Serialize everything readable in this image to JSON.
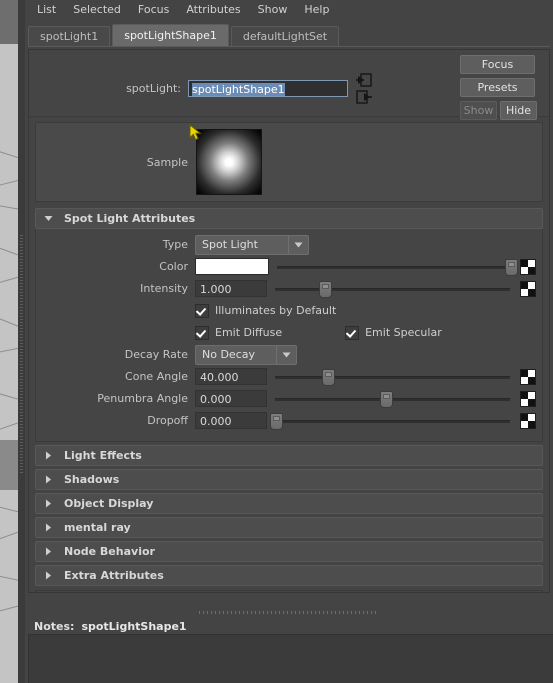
{
  "menu": {
    "items": [
      {
        "label": "List"
      },
      {
        "label": "Selected"
      },
      {
        "label": "Focus"
      },
      {
        "label": "Attributes"
      },
      {
        "label": "Show"
      },
      {
        "label": "Help"
      }
    ]
  },
  "tabs": [
    {
      "label": "spotLight1",
      "active": false
    },
    {
      "label": "spotLightShape1",
      "active": true
    },
    {
      "label": "defaultLightSet",
      "active": false
    }
  ],
  "node_header": {
    "type_label": "spotLight:",
    "name_value": "spotLightShape1",
    "focus_button": "Focus",
    "presets_button": "Presets",
    "show_button": "Show",
    "hide_button": "Hide",
    "go_to_input_icon": "arrow-into-box-icon",
    "go_to_output_icon": "arrow-out-of-box-icon"
  },
  "sample": {
    "label": "Sample",
    "swatch_center_color": "#ffffff",
    "swatch_edge_color": "#050505",
    "cursor_color": "#ecd400"
  },
  "spot_light_attributes": {
    "title": "Spot Light Attributes",
    "expanded": true,
    "type": {
      "label": "Type",
      "value": "Spot Light"
    },
    "color": {
      "label": "Color",
      "value": "#ffffff",
      "slider_percent": 100,
      "map_button_icon": "checker-map-icon"
    },
    "intensity": {
      "label": "Intensity",
      "value": "1.000",
      "slider_percent": 21,
      "map_button_icon": "checker-map-icon"
    },
    "illuminates_by_default": {
      "label": "Illuminates by Default",
      "checked": true
    },
    "emit_diffuse": {
      "label": "Emit Diffuse",
      "checked": true
    },
    "emit_specular": {
      "label": "Emit Specular",
      "checked": true
    },
    "decay_rate": {
      "label": "Decay Rate",
      "value": "No Decay"
    },
    "cone_angle": {
      "label": "Cone Angle",
      "value": "40.000",
      "slider_percent": 22,
      "map_button_icon": "checker-map-icon"
    },
    "penumbra_angle": {
      "label": "Penumbra Angle",
      "value": "0.000",
      "slider_percent": 47,
      "map_button_icon": "checker-map-icon"
    },
    "dropoff": {
      "label": "Dropoff",
      "value": "0.000",
      "slider_percent": 0,
      "map_button_icon": "checker-map-icon"
    }
  },
  "collapsed_sections": [
    {
      "title": "Light Effects"
    },
    {
      "title": "Shadows"
    },
    {
      "title": "Object Display"
    },
    {
      "title": "mental ray"
    },
    {
      "title": "Node Behavior"
    },
    {
      "title": "Extra Attributes"
    }
  ],
  "notes": {
    "label": "Notes:",
    "node_name": "spotLightShape1",
    "text": ""
  },
  "colors": {
    "panel_bg": "#444444",
    "field_bg": "#3b3b3b",
    "section_header_bg": "#4d4d4d",
    "active_tab_bg": "#6a6a6a",
    "selection_blue": "#6a8cb5",
    "text": "#c8c8c8"
  }
}
